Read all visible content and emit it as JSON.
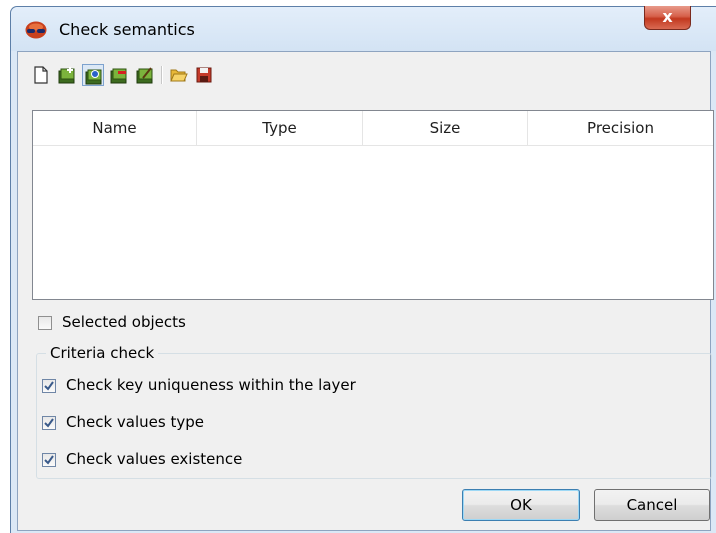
{
  "window": {
    "title": "Check semantics",
    "close_label": "x"
  },
  "toolbar": {
    "buttons": [
      {
        "icon": "new-document-icon"
      },
      {
        "icon": "add-semantic-icon"
      },
      {
        "icon": "edit-semantic-icon",
        "pressed": true
      },
      {
        "icon": "delete-semantic-icon"
      },
      {
        "icon": "properties-semantic-icon"
      },
      {
        "icon": "open-folder-icon"
      },
      {
        "icon": "save-icon"
      }
    ]
  },
  "table": {
    "columns": [
      "Name",
      "Type",
      "Size",
      "Precision"
    ],
    "rows": []
  },
  "selected_objects": {
    "label": "Selected objects",
    "checked": false
  },
  "criteria": {
    "title": "Criteria check",
    "items": [
      {
        "label": "Check key uniqueness within the layer",
        "checked": true
      },
      {
        "label": "Check values type",
        "checked": true
      },
      {
        "label": "Check values existence",
        "checked": true
      }
    ]
  },
  "buttons": {
    "ok": "OK",
    "cancel": "Cancel"
  },
  "colors": {
    "title_bg": "#dbe8f6",
    "close_red": "#c2381f",
    "client_bg": "#f0f0f0"
  }
}
